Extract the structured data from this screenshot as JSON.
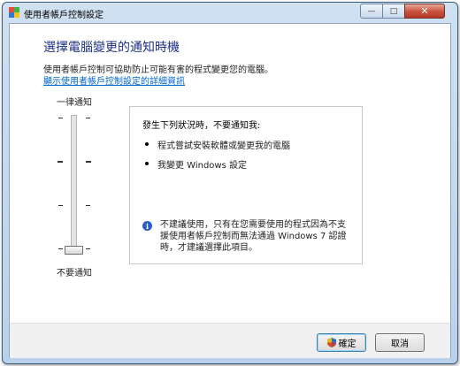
{
  "window": {
    "title": "使用者帳戶控制設定",
    "close_symbol": "✕",
    "min_symbol": "—",
    "max_symbol": "□"
  },
  "main": {
    "heading": "選擇電腦變更的通知時機",
    "description": "使用者帳戶控制可協助防止可能有害的程式變更您的電腦。",
    "link": "顯示使用者帳戶控制設定的詳細資訊"
  },
  "slider": {
    "top_label": "一律通知",
    "bottom_label": "不要通知",
    "level": 0
  },
  "panel": {
    "title": "發生下列狀況時，不要通知我:",
    "bullets": [
      "程式嘗試安裝軟體或變更我的電腦",
      "我變更 Windows 設定"
    ],
    "info_text": "不建議使用，只有在您需要使用的程式因為不支援使用者帳戶控制而無法通過 Windows 7 認證時，才建議選擇此項目。",
    "info_symbol": "i"
  },
  "buttons": {
    "ok": "確定",
    "cancel": "取消"
  }
}
